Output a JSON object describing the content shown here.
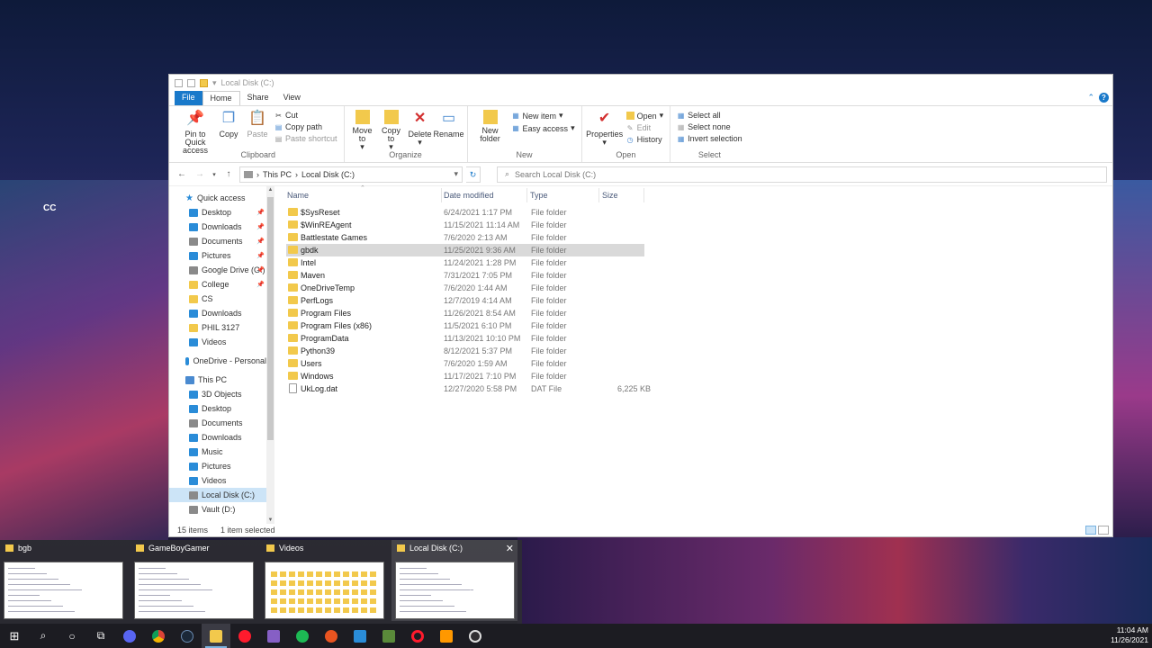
{
  "desktop": {
    "label": "CC"
  },
  "window": {
    "title": "Local Disk (C:)",
    "tabs": {
      "file": "File",
      "home": "Home",
      "share": "Share",
      "view": "View"
    },
    "ribbon": {
      "clipboard": {
        "label": "Clipboard",
        "pin": "Pin to Quick access",
        "copy": "Copy",
        "paste": "Paste",
        "cut": "Cut",
        "copy_path": "Copy path",
        "paste_shortcut": "Paste shortcut"
      },
      "organize": {
        "label": "Organize",
        "move_to": "Move to",
        "copy_to": "Copy to",
        "delete": "Delete",
        "rename": "Rename"
      },
      "new": {
        "label": "New",
        "new_folder": "New folder",
        "new_item": "New item",
        "easy_access": "Easy access"
      },
      "open": {
        "label": "Open",
        "properties": "Properties",
        "open": "Open",
        "edit": "Edit",
        "history": "History"
      },
      "select": {
        "label": "Select",
        "select_all": "Select all",
        "select_none": "Select none",
        "invert": "Invert selection"
      }
    },
    "address": {
      "crumb1": "This PC",
      "crumb2": "Local Disk (C:)",
      "search_placeholder": "Search Local Disk (C:)"
    },
    "nav": {
      "quick_access": "Quick access",
      "qa_items": [
        "Desktop",
        "Downloads",
        "Documents",
        "Pictures",
        "Google Drive (G:)",
        "College",
        "CS",
        "Downloads",
        "PHIL 3127",
        "Videos"
      ],
      "onedrive": "OneDrive - Personal",
      "this_pc": "This PC",
      "pc_items": [
        "3D Objects",
        "Desktop",
        "Documents",
        "Downloads",
        "Music",
        "Pictures",
        "Videos",
        "Local Disk (C:)",
        "Vault (D:)"
      ]
    },
    "columns": {
      "name": "Name",
      "date": "Date modified",
      "type": "Type",
      "size": "Size"
    },
    "files": [
      {
        "name": "$SysReset",
        "date": "6/24/2021 1:17 PM",
        "type": "File folder",
        "size": ""
      },
      {
        "name": "$WinREAgent",
        "date": "11/15/2021 11:14 AM",
        "type": "File folder",
        "size": ""
      },
      {
        "name": "Battlestate Games",
        "date": "7/6/2020 2:13 AM",
        "type": "File folder",
        "size": ""
      },
      {
        "name": "gbdk",
        "date": "11/25/2021 9:36 AM",
        "type": "File folder",
        "size": ""
      },
      {
        "name": "Intel",
        "date": "11/24/2021 1:28 PM",
        "type": "File folder",
        "size": ""
      },
      {
        "name": "Maven",
        "date": "7/31/2021 7:05 PM",
        "type": "File folder",
        "size": ""
      },
      {
        "name": "OneDriveTemp",
        "date": "7/6/2020 1:44 AM",
        "type": "File folder",
        "size": ""
      },
      {
        "name": "PerfLogs",
        "date": "12/7/2019 4:14 AM",
        "type": "File folder",
        "size": ""
      },
      {
        "name": "Program Files",
        "date": "11/26/2021 8:54 AM",
        "type": "File folder",
        "size": ""
      },
      {
        "name": "Program Files (x86)",
        "date": "11/5/2021 6:10 PM",
        "type": "File folder",
        "size": ""
      },
      {
        "name": "ProgramData",
        "date": "11/13/2021 10:10 PM",
        "type": "File folder",
        "size": ""
      },
      {
        "name": "Python39",
        "date": "8/12/2021 5:37 PM",
        "type": "File folder",
        "size": ""
      },
      {
        "name": "Users",
        "date": "7/6/2020 1:59 AM",
        "type": "File folder",
        "size": ""
      },
      {
        "name": "Windows",
        "date": "11/17/2021 7:10 PM",
        "type": "File folder",
        "size": ""
      },
      {
        "name": "UkLog.dat",
        "date": "12/27/2020 5:58 PM",
        "type": "DAT File",
        "size": "6,225 KB"
      }
    ],
    "status": {
      "count": "15 items",
      "selected": "1 item selected"
    }
  },
  "switcher": [
    {
      "title": "bgb"
    },
    {
      "title": "GameBoyGamer"
    },
    {
      "title": "Videos"
    },
    {
      "title": "Local Disk (C:)"
    }
  ],
  "taskbar": {
    "time": "11:04 AM",
    "date": "11/26/2021"
  },
  "colors": {
    "accent": "#1979ca",
    "folder": "#f2c94c",
    "selection": "#cce4f7"
  }
}
